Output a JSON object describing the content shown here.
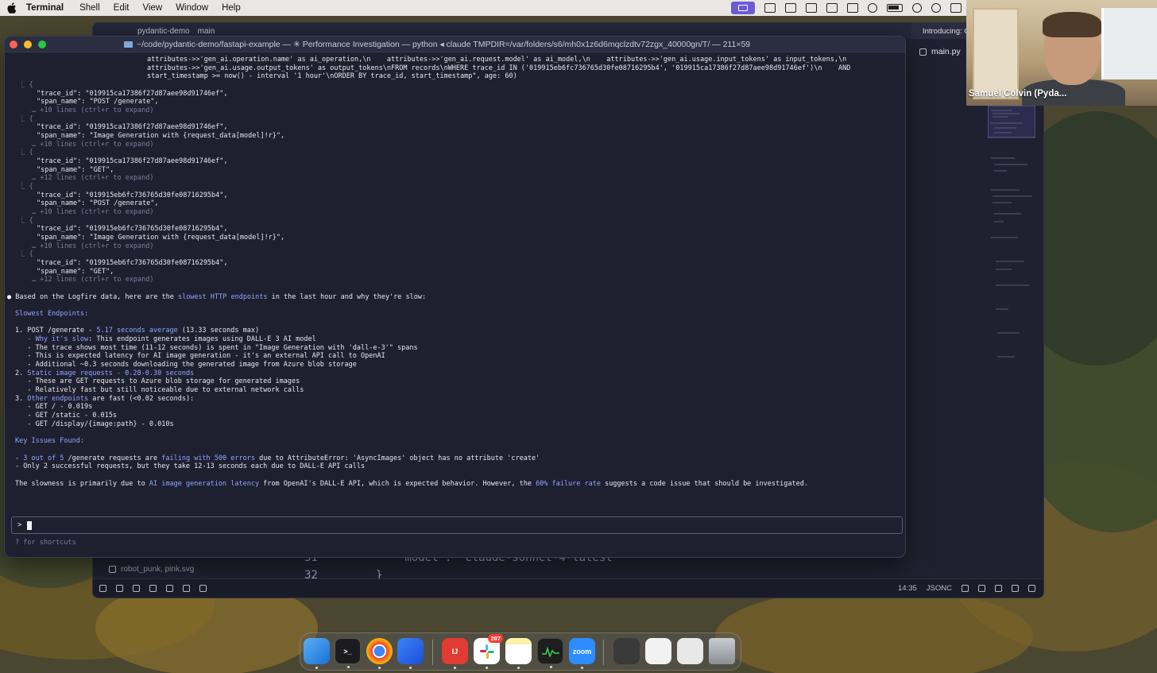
{
  "menubar": {
    "items": [
      "Terminal",
      "Shell",
      "Edit",
      "View",
      "Window",
      "Help"
    ]
  },
  "editor": {
    "project": "pydantic-demo",
    "branch": "main",
    "other_tab": "Introducing: C",
    "file_tab": "main.py",
    "code_line_31_num": "31",
    "code_line_31_text": "\"model\": \"claude-sonnet-4-latest\"",
    "code_line_32_num": "32",
    "code_line_32_text": "}",
    "explorer_file": "robot_punk, pink.svg",
    "status": {
      "time": "14:35",
      "language": "JSONC"
    }
  },
  "terminal": {
    "title": "~/code/pydantic-demo/fastapi-example — ✳ Performance Investigation — python ◂ claude TMPDIR=/var/folders/s6/mh0x1z6d6mqclzdtv72zgx_40000gn/T/ — 211×59",
    "query_lines": [
      "attributes->>'gen_ai.operation.name' as ai_operation,\\n    attributes->>'gen_ai.request.model' as ai_model,\\n    attributes->>'gen_ai.usage.input_tokens' as input_tokens,\\n",
      "attributes->>'gen_ai.usage.output_tokens' as output_tokens\\nFROM records\\nWHERE trace_id IN ('019915eb6fc736765d30fe08716295b4', '019915ca17386f27d87aee98d91746ef')\\n    AND",
      "start_timestamp >= now() - interval '1 hour'\\nORDER BY trace_id, start_timestamp\", age: 60)"
    ],
    "records": [
      {
        "open": "⎿ {",
        "trace": "\"trace_id\": \"019915ca17386f27d87aee98d91746ef\",",
        "span": "\"span_name\": \"POST /generate\",",
        "more": "… +10 lines (ctrl+r to expand)"
      },
      {
        "open": "⎿ {",
        "trace": "\"trace_id\": \"019915ca17386f27d87aee98d91746ef\",",
        "span": "\"span_name\": \"Image Generation with {request_data[model]!r}\",",
        "more": "… +10 lines (ctrl+r to expand)"
      },
      {
        "open": "⎿ {",
        "trace": "\"trace_id\": \"019915ca17386f27d87aee98d91746ef\",",
        "span": "\"span_name\": \"GET\",",
        "more": "… +12 lines (ctrl+r to expand)"
      },
      {
        "open": "⎿ {",
        "trace": "\"trace_id\": \"019915eb6fc736765d30fe08716295b4\",",
        "span": "\"span_name\": \"POST /generate\",",
        "more": "… +10 lines (ctrl+r to expand)"
      },
      {
        "open": "⎿ {",
        "trace": "\"trace_id\": \"019915eb6fc736765d30fe08716295b4\",",
        "span": "\"span_name\": \"Image Generation with {request_data[model]!r}\",",
        "more": "… +10 lines (ctrl+r to expand)"
      },
      {
        "open": "⎿ {",
        "trace": "\"trace_id\": \"019915eb6fc736765d30fe08716295b4\",",
        "span": "\"span_name\": \"GET\",",
        "more": "… +12 lines (ctrl+r to expand)"
      }
    ],
    "summary": {
      "intro_a": "Based on the Logfire data, here are the ",
      "intro_hl": "slowest HTTP endpoints",
      "intro_b": " in the last hour and why they're slow:",
      "slowest_heading": "Slowest Endpoints:",
      "e1_a": "1. POST /generate - ",
      "e1_hl": "5.17 seconds average",
      "e1_b": " (13.33 seconds max)",
      "e1_why_hl": "   - Why it's slow",
      "e1_why_b": ": This endpoint generates images using DALL-E 3 AI model",
      "e1_l2": "   - The trace shows most time (11-12 seconds) is spent in \"Image Generation with 'dall-e-3'\" spans",
      "e1_l3": "   - This is expected latency for AI image generation - it's an external API call to OpenAI",
      "e1_l4": "   - Additional ~0.3 seconds downloading the generated image from Azure blob storage",
      "e2_a": "2. ",
      "e2_hl": "Static image requests - 0.28-0.30 seconds",
      "e2_l1": "   - These are GET requests to Azure blob storage for generated images",
      "e2_l2": "   - Relatively fast but still noticeable due to external network calls",
      "e3_a": "3. ",
      "e3_hl": "Other endpoints",
      "e3_b": " are fast (<0.02 seconds):",
      "e3_l1": "   - GET / - 0.019s",
      "e3_l2": "   - GET /static - 0.015s",
      "e3_l3": "   - GET /display/{image:path} - 0.010s",
      "issues_heading": "Key Issues Found:",
      "i1_a": "- ",
      "i1_hl1": "3 out of 5",
      "i1_b": " /generate requests are ",
      "i1_hl2": "failing with 500 errors",
      "i1_c": " due to AttributeError: 'AsyncImages' object has no attribute 'create'",
      "i2": "- Only 2 successful requests, but they take 12-13 seconds each due to DALL-E API calls",
      "concl_a": "The slowness is primarily due to ",
      "concl_hl1": "AI image generation latency",
      "concl_b": " from OpenAI's DALL-E API, which is expected behavior. However, the ",
      "concl_hl2": "60% failure rate",
      "concl_c": " suggests a code issue that should be investigated."
    },
    "prompt_symbol": ">",
    "shortcut_hint": "? for shortcuts"
  },
  "video": {
    "participant_name": "Samuel Colvin (Pyda..."
  },
  "dock": {
    "slack_badge": "287",
    "zoom_label": "zoom"
  }
}
